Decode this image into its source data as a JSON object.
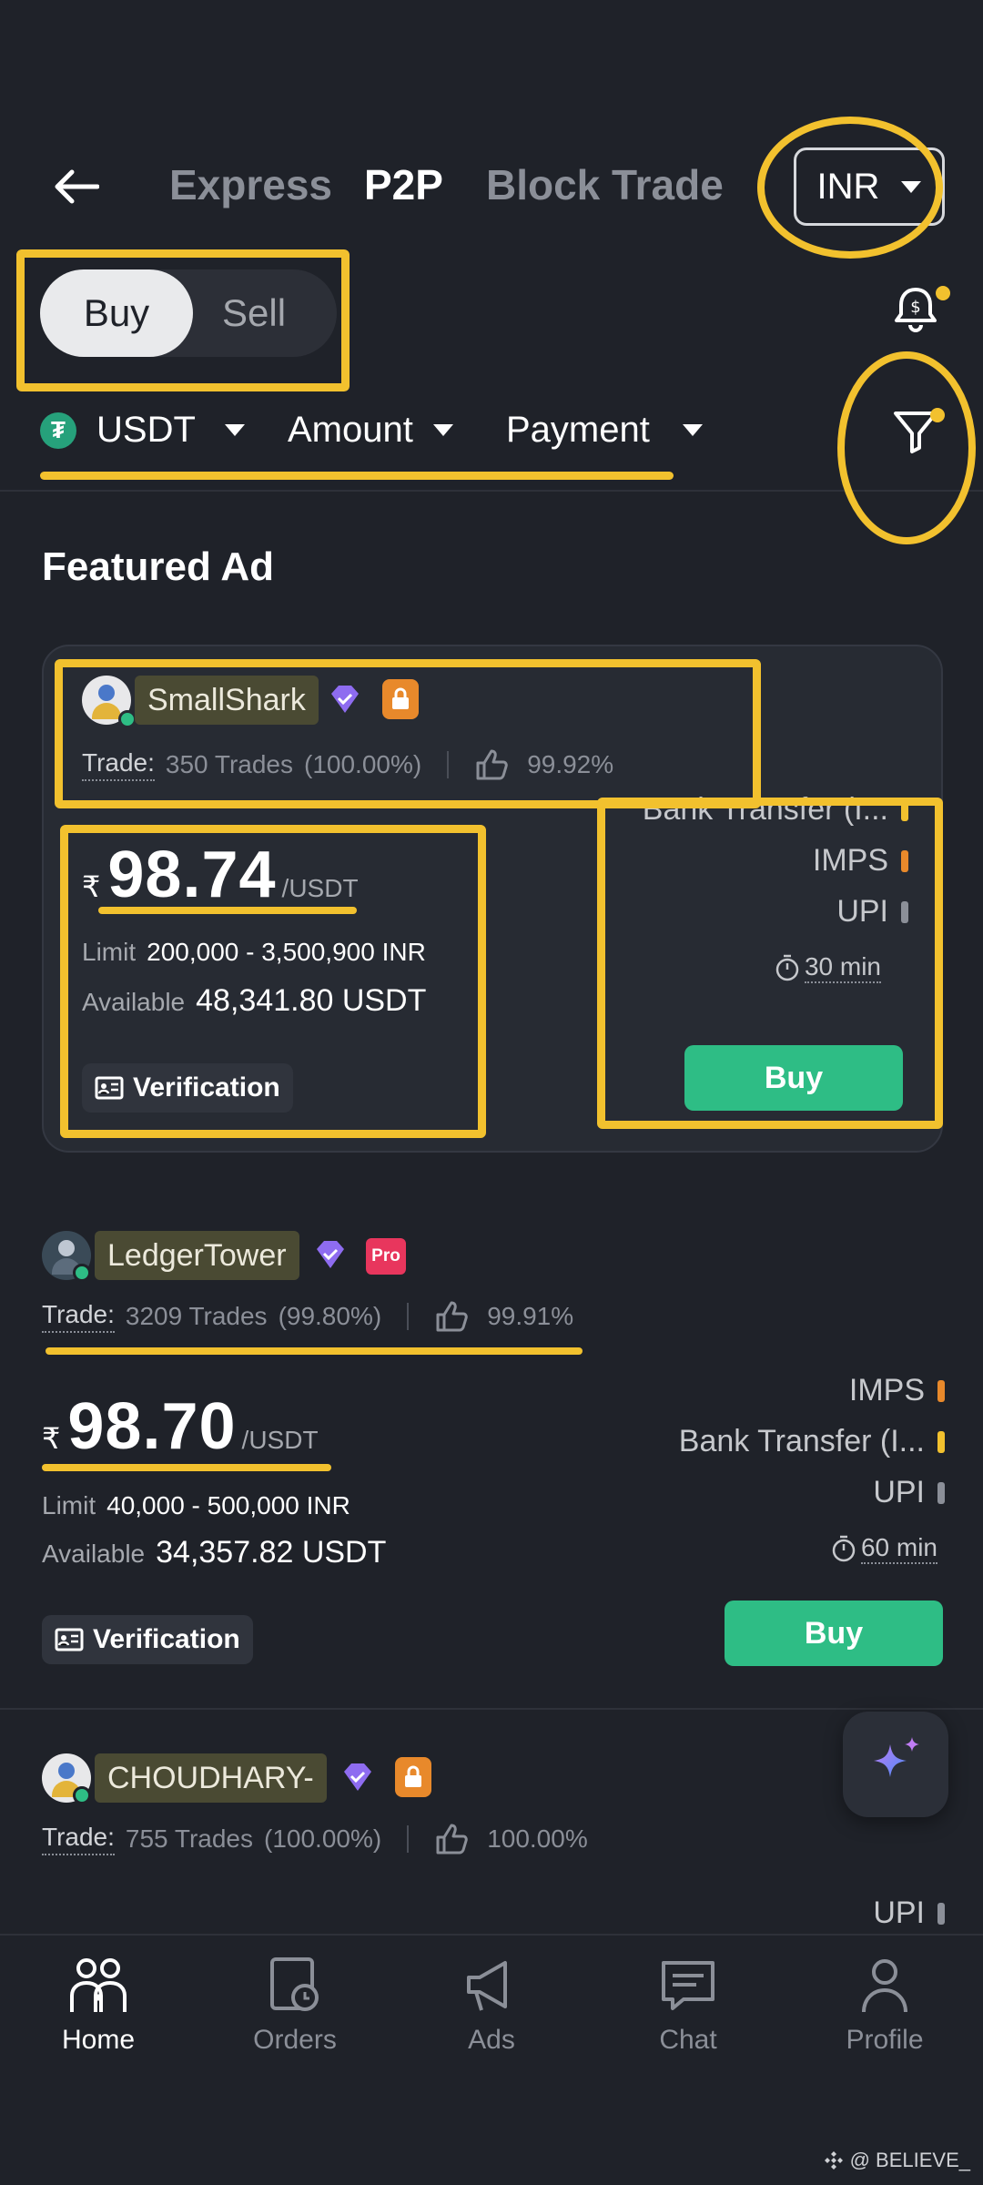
{
  "header": {
    "tabs": [
      {
        "label": "Express",
        "active": false
      },
      {
        "label": "P2P",
        "active": true
      },
      {
        "label": "Block Trade",
        "active": false
      }
    ],
    "currency": "INR"
  },
  "side_toggle": {
    "buy": "Buy",
    "sell": "Sell",
    "selected": "Buy"
  },
  "filters": {
    "coin": "USDT",
    "amount": "Amount",
    "payment": "Payment"
  },
  "section_title": "Featured Ad",
  "ads": [
    {
      "name": "SmallShark",
      "trade_label": "Trade:",
      "trades": "350 Trades",
      "completion": "(100.00%)",
      "rating": "99.92%",
      "currency_symbol": "₹",
      "price": "98.74",
      "unit": "/USDT",
      "limit_label": "Limit",
      "limit": "200,000 - 3,500,900 INR",
      "available_label": "Available",
      "available": "48,341.80 USDT",
      "verification": "Verification",
      "payments": [
        "Bank Transfer (I...",
        "IMPS",
        "UPI"
      ],
      "time": "30 min",
      "buy": "Buy"
    },
    {
      "name": "LedgerTower",
      "pro_label": "Pro",
      "trade_label": "Trade:",
      "trades": "3209 Trades",
      "completion": "(99.80%)",
      "rating": "99.91%",
      "currency_symbol": "₹",
      "price": "98.70",
      "unit": "/USDT",
      "limit_label": "Limit",
      "limit": "40,000 - 500,000 INR",
      "available_label": "Available",
      "available": "34,357.82 USDT",
      "verification": "Verification",
      "payments": [
        "IMPS",
        "Bank Transfer (I...",
        "UPI"
      ],
      "time": "60 min",
      "buy": "Buy"
    },
    {
      "name": "CHOUDHARY-",
      "trade_label": "Trade:",
      "trades": "755 Trades",
      "completion": "(100.00%)",
      "rating": "100.00%",
      "payments": [
        "UPI"
      ]
    }
  ],
  "bottom_nav": [
    {
      "label": "Home",
      "active": true
    },
    {
      "label": "Orders",
      "active": false
    },
    {
      "label": "Ads",
      "active": false
    },
    {
      "label": "Chat",
      "active": false
    },
    {
      "label": "Profile",
      "active": false
    }
  ],
  "watermark": "@ BELIEVE_",
  "colors": {
    "background": "#1f2229",
    "accent_green": "#2ebd85",
    "highlight": "#f2c12e",
    "imps_bar": "#e8892b",
    "bank_bar": "#f2c12e",
    "upi_bar": "#8b8f98"
  }
}
